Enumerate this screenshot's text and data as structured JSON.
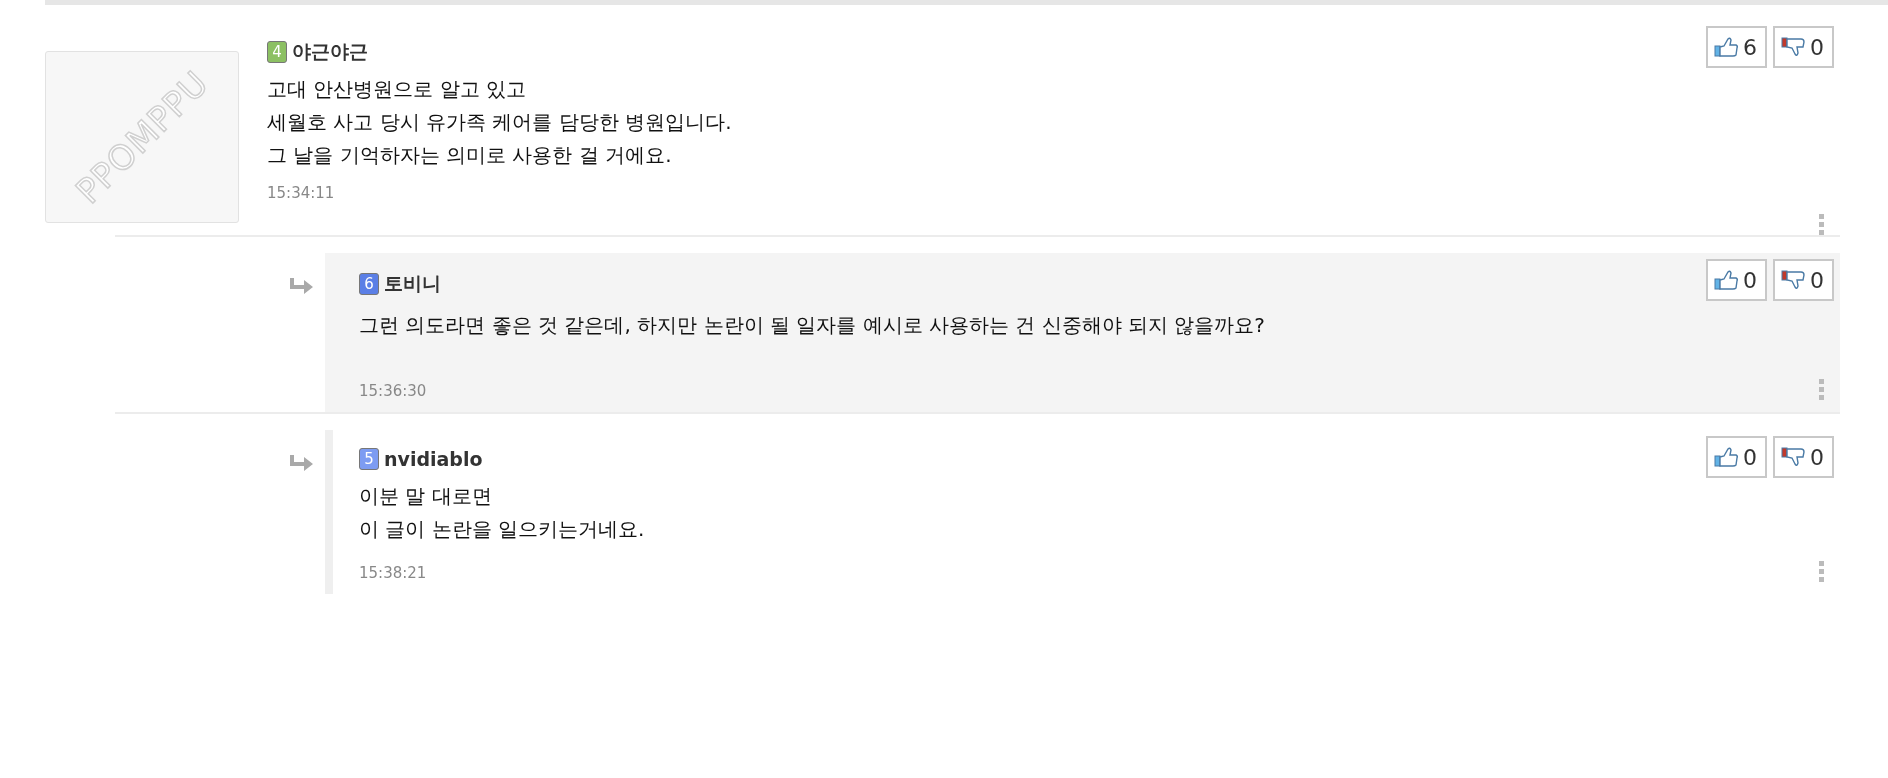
{
  "comments": [
    {
      "avatar": {
        "label": "PPOMPPU"
      },
      "level": "4",
      "color": "#8cc063",
      "author": "야근야근",
      "body": "고대 안산병원으로 알고 있고\n세월호 사고 당시 유가족 케어를 담당한 병원입니다.\n그 날을 기억하자는 의미로 사용한 걸 거에요.",
      "time": "15:34:11",
      "likes": "6",
      "dislikes": "0",
      "replies": [
        {
          "highlighted": true,
          "level": "6",
          "color": "#5b7fe6",
          "author": "토비니",
          "body": "그런 의도라면 좋은 것 같은데, 하지만 논란이 될 일자를 예시로 사용하는 건 신중해야 되지 않을까요?",
          "time": "15:36:30",
          "likes": "0",
          "dislikes": "0"
        },
        {
          "highlighted": false,
          "level": "5",
          "color": "#7d9cf2",
          "author": "nvidiablo",
          "body": "이분 말 대로면\n이 글이 논란을 일으키는거네요.",
          "time": "15:38:21",
          "likes": "0",
          "dislikes": "0"
        }
      ]
    }
  ]
}
